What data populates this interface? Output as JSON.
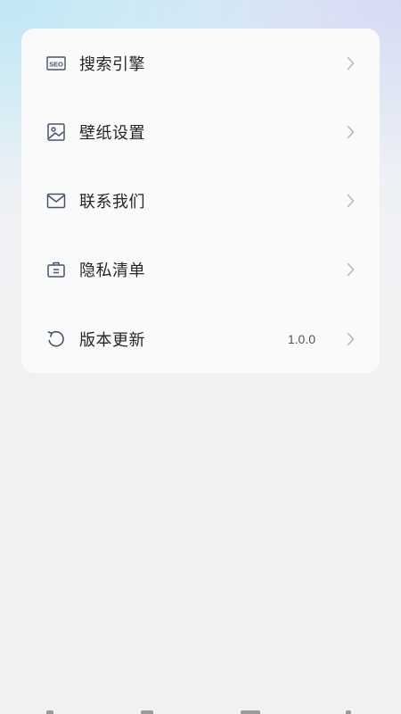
{
  "settings": {
    "items": [
      {
        "label": "搜索引擎",
        "icon": "seo-icon",
        "value": ""
      },
      {
        "label": "壁纸设置",
        "icon": "image-icon",
        "value": ""
      },
      {
        "label": "联系我们",
        "icon": "mail-icon",
        "value": ""
      },
      {
        "label": "隐私清单",
        "icon": "briefcase-icon",
        "value": ""
      },
      {
        "label": "版本更新",
        "icon": "refresh-icon",
        "value": "1.0.0"
      }
    ]
  },
  "icon_text": {
    "seo": "SEO"
  },
  "colors": {
    "icon_stroke": "#44546a",
    "chevron": "#b5b5b5",
    "card_bg": "#fafafa"
  }
}
